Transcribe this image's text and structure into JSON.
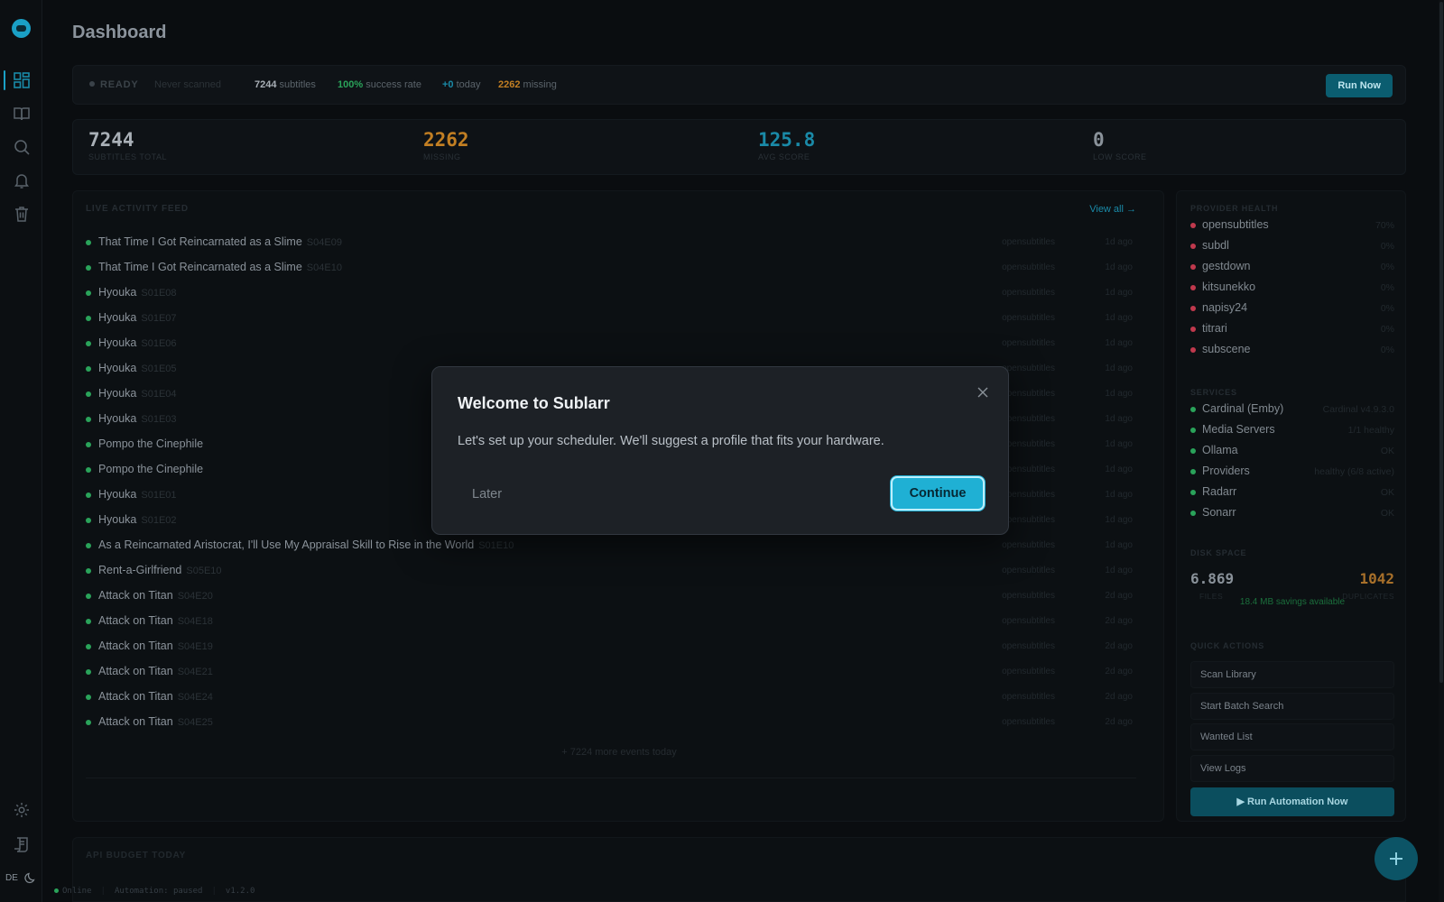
{
  "app": {
    "language": "DE"
  },
  "header": {
    "title": "Dashboard"
  },
  "status": {
    "state": "READY",
    "last_scan": "Never scanned",
    "subtitles_count": "7244",
    "subtitles_label": "subtitles",
    "success_rate": "100%",
    "success_label": "success rate",
    "today_count": "+0",
    "today_label": "today",
    "missing_count": "2262",
    "missing_label": "missing",
    "run_now_label": "Run Now"
  },
  "stats": [
    {
      "value": "7244",
      "label": "SUBTITLES TOTAL",
      "color": "#a9b0b7"
    },
    {
      "value": "2262",
      "label": "MISSING",
      "color": "#c27f23"
    },
    {
      "value": "125.8",
      "label": "AVG SCORE",
      "color": "#1a8aa8"
    },
    {
      "value": "0",
      "label": "LOW SCORE",
      "color": "#8a929a"
    }
  ],
  "feed": {
    "title": "LIVE ACTIVITY FEED",
    "view_all": "View all →",
    "items": [
      {
        "title": "That Time I Got Reincarnated as a Slime",
        "episode": "S04E09",
        "source": "opensubtitles",
        "ago": "1d ago"
      },
      {
        "title": "That Time I Got Reincarnated as a Slime",
        "episode": "S04E10",
        "source": "opensubtitles",
        "ago": "1d ago"
      },
      {
        "title": "Hyouka",
        "episode": "S01E08",
        "source": "opensubtitles",
        "ago": "1d ago"
      },
      {
        "title": "Hyouka",
        "episode": "S01E07",
        "source": "opensubtitles",
        "ago": "1d ago"
      },
      {
        "title": "Hyouka",
        "episode": "S01E06",
        "source": "opensubtitles",
        "ago": "1d ago"
      },
      {
        "title": "Hyouka",
        "episode": "S01E05",
        "source": "opensubtitles",
        "ago": "1d ago"
      },
      {
        "title": "Hyouka",
        "episode": "S01E04",
        "source": "opensubtitles",
        "ago": "1d ago"
      },
      {
        "title": "Hyouka",
        "episode": "S01E03",
        "source": "opensubtitles",
        "ago": "1d ago"
      },
      {
        "title": "Pompo the Cinephile",
        "episode": "",
        "source": "opensubtitles",
        "ago": "1d ago"
      },
      {
        "title": "Pompo the Cinephile",
        "episode": "",
        "source": "opensubtitles",
        "ago": "1d ago"
      },
      {
        "title": "Hyouka",
        "episode": "S01E01",
        "source": "opensubtitles",
        "ago": "1d ago"
      },
      {
        "title": "Hyouka",
        "episode": "S01E02",
        "source": "opensubtitles",
        "ago": "1d ago"
      },
      {
        "title": "As a Reincarnated Aristocrat, I'll Use My Appraisal Skill to Rise in the World",
        "episode": "S01E10",
        "source": "opensubtitles",
        "ago": "1d ago"
      },
      {
        "title": "Rent-a-Girlfriend",
        "episode": "S05E10",
        "source": "opensubtitles",
        "ago": "1d ago"
      },
      {
        "title": "Attack on Titan",
        "episode": "S04E20",
        "source": "opensubtitles",
        "ago": "2d ago"
      },
      {
        "title": "Attack on Titan",
        "episode": "S04E18",
        "source": "opensubtitles",
        "ago": "2d ago"
      },
      {
        "title": "Attack on Titan",
        "episode": "S04E19",
        "source": "opensubtitles",
        "ago": "2d ago"
      },
      {
        "title": "Attack on Titan",
        "episode": "S04E21",
        "source": "opensubtitles",
        "ago": "2d ago"
      },
      {
        "title": "Attack on Titan",
        "episode": "S04E24",
        "source": "opensubtitles",
        "ago": "2d ago"
      },
      {
        "title": "Attack on Titan",
        "episode": "S04E25",
        "source": "opensubtitles",
        "ago": "2d ago"
      }
    ],
    "more_events": "+ 7224 more events today"
  },
  "provider_health": {
    "title": "PROVIDER HEALTH",
    "items": [
      {
        "name": "opensubtitles",
        "status": "70%"
      },
      {
        "name": "subdl",
        "status": "0%"
      },
      {
        "name": "gestdown",
        "status": "0%"
      },
      {
        "name": "kitsunekko",
        "status": "0%"
      },
      {
        "name": "napisy24",
        "status": "0%"
      },
      {
        "name": "titrari",
        "status": "0%"
      },
      {
        "name": "subscene",
        "status": "0%"
      }
    ],
    "dot_color": "#c0394d"
  },
  "services": {
    "title": "SERVICES",
    "items": [
      {
        "name": "Cardinal (Emby)",
        "status": "Cardinal v4.9.3.0"
      },
      {
        "name": "Media Servers",
        "status": "1/1 healthy"
      },
      {
        "name": "Ollama",
        "status": "OK"
      },
      {
        "name": "Providers",
        "status": "healthy (6/8 active)"
      },
      {
        "name": "Radarr",
        "status": "OK"
      },
      {
        "name": "Sonarr",
        "status": "OK"
      }
    ],
    "dot_color": "#2aa35a"
  },
  "disk_space": {
    "title": "DISK SPACE",
    "files_value": "6.869",
    "files_label": "FILES",
    "duplicates_value": "1042",
    "duplicates_label": "DUPLICATES",
    "savings": "18.4 MB savings available"
  },
  "quick_actions": {
    "title": "QUICK ACTIONS",
    "items": [
      "Scan Library",
      "Start Batch Search",
      "Wanted List",
      "View Logs"
    ],
    "run_automation": "▶ Run Automation Now"
  },
  "api_budget": {
    "title": "API BUDGET TODAY"
  },
  "footer": {
    "status": "Online",
    "automation": "Automation: paused",
    "version": "v1.2.0"
  },
  "modal": {
    "title": "Welcome to Sublarr",
    "body": "Let's set up your scheduler. We'll suggest a profile that fits your hardware.",
    "later_label": "Later",
    "continue_label": "Continue"
  },
  "colors": {
    "accent": "#1fb0d4",
    "success": "#2aa35a",
    "warning": "#c27f23",
    "danger": "#c0394d"
  }
}
